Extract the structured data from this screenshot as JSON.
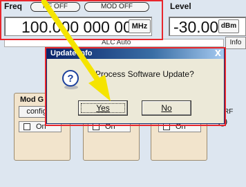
{
  "header": {
    "freq_label": "Freq",
    "rf_toggle": "RF OFF",
    "mod_toggle": "MOD OFF",
    "level_label": "Level",
    "freq_value": "100.000 000 000",
    "freq_unit": "MHz",
    "level_value": "-30.00",
    "level_unit": "dBm"
  },
  "status": {
    "alc_text": "ALC Auto",
    "info_button": "Info"
  },
  "blocks": [
    {
      "title": "Mod G",
      "config_label": "config",
      "on_label": "On"
    },
    {
      "title": "",
      "on_label": "On"
    },
    {
      "title": "",
      "on_label": "On"
    }
  ],
  "rf_output_label": "RF",
  "dialog": {
    "title": "Update info",
    "close": "X",
    "message": "Process Software Update?",
    "yes_label": "Yes",
    "no_label": "No"
  },
  "colors": {
    "highlight_rect": "#e8262c",
    "pointer_arrow": "#f5e400",
    "block_fill": "#f2e4cc",
    "title_bar": "#0a246a"
  }
}
